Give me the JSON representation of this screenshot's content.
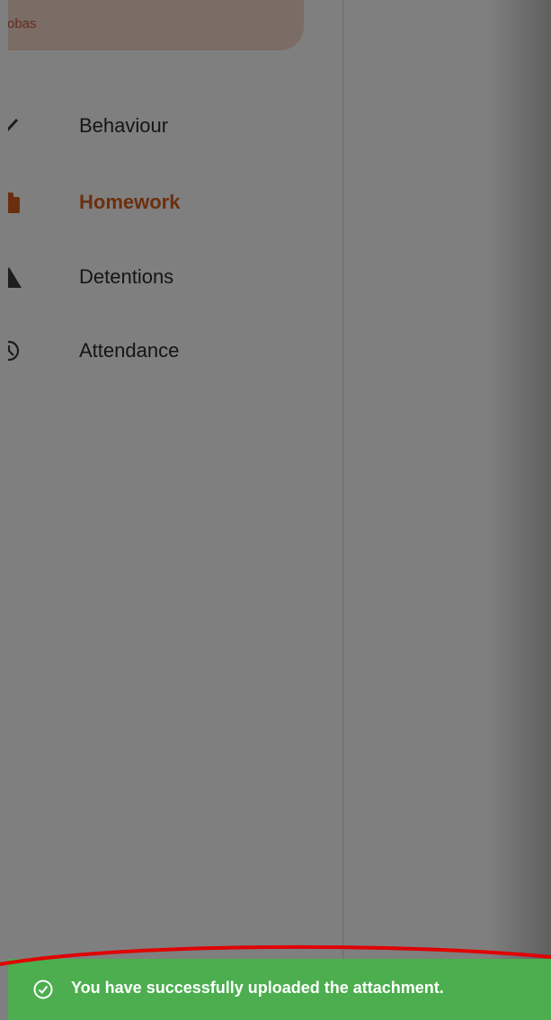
{
  "sidebar": {
    "user_chip_text": "obas",
    "items": [
      {
        "label": "Behaviour",
        "icon": "check-icon",
        "active": false
      },
      {
        "label": "Homework",
        "icon": "clipboard-icon",
        "active": true
      },
      {
        "label": "Detentions",
        "icon": "warning-triangle-icon",
        "active": false
      },
      {
        "label": "Attendance",
        "icon": "clock-icon",
        "active": false
      }
    ]
  },
  "toast": {
    "message": "You have successfully uploaded the attachment.",
    "icon": "check-circle-icon",
    "color": "#4cae4f"
  },
  "colors": {
    "accent": "#d85f1d",
    "chip_background": "#f6d8ca",
    "annotation": "#e00000"
  }
}
